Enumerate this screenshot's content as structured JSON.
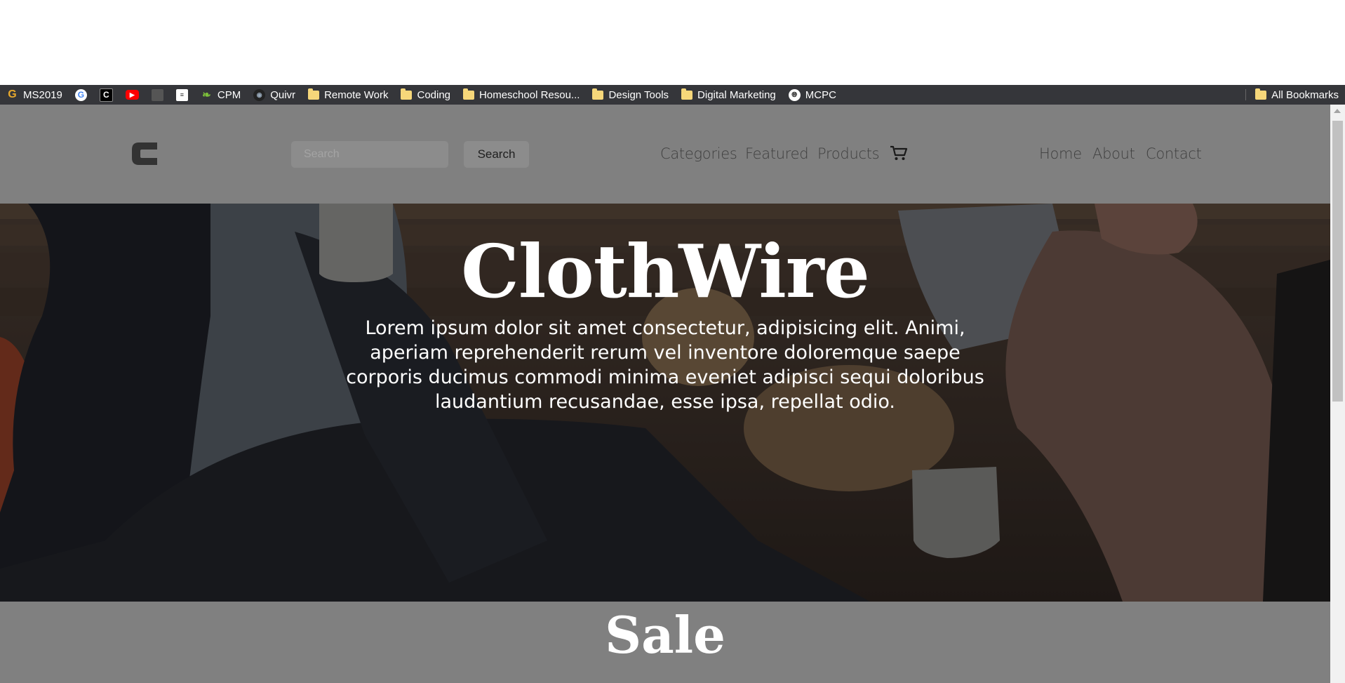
{
  "bookmarks": {
    "items": [
      {
        "label": "MS2019",
        "icon": "g-logo-icon"
      },
      {
        "label": "",
        "icon": "google-icon"
      },
      {
        "label": "",
        "icon": "c-square-icon"
      },
      {
        "label": "",
        "icon": "youtube-icon"
      },
      {
        "label": "",
        "icon": "grey-square-icon"
      },
      {
        "label": "",
        "icon": "white-page-icon"
      },
      {
        "label": "CPM",
        "icon": "leaf-icon"
      },
      {
        "label": "Quivr",
        "icon": "quivr-icon"
      },
      {
        "label": "Remote Work",
        "icon": "folder-icon"
      },
      {
        "label": "Coding",
        "icon": "folder-icon"
      },
      {
        "label": "Homeschool Resou...",
        "icon": "folder-icon"
      },
      {
        "label": "Design Tools",
        "icon": "folder-icon"
      },
      {
        "label": "Digital Marketing",
        "icon": "folder-icon"
      },
      {
        "label": "MCPC",
        "icon": "globe-icon"
      }
    ],
    "all_bookmarks": "All Bookmarks"
  },
  "navbar": {
    "logo": "C",
    "search": {
      "placeholder": "Search",
      "button": "Search"
    },
    "links_center": [
      "Categories",
      "Featured",
      "Products"
    ],
    "links_right": [
      "Home",
      "About",
      "Contact"
    ]
  },
  "hero": {
    "title": "ClothWire",
    "text": "Lorem ipsum dolor sit amet consectetur, adipisicing elit. Animi, aperiam reprehenderit rerum vel inventore doloremque saepe corporis ducimus commodi minima eveniet adipisci sequi doloribus laudantium recusandae, esse ipsa, repellat odio."
  },
  "sale": {
    "title": "Sale"
  },
  "colors": {
    "page_bg": "#808080",
    "bookmarks_bg": "#35363a",
    "nav_text": "#3f3f3f",
    "hero_text": "#ffffff"
  }
}
